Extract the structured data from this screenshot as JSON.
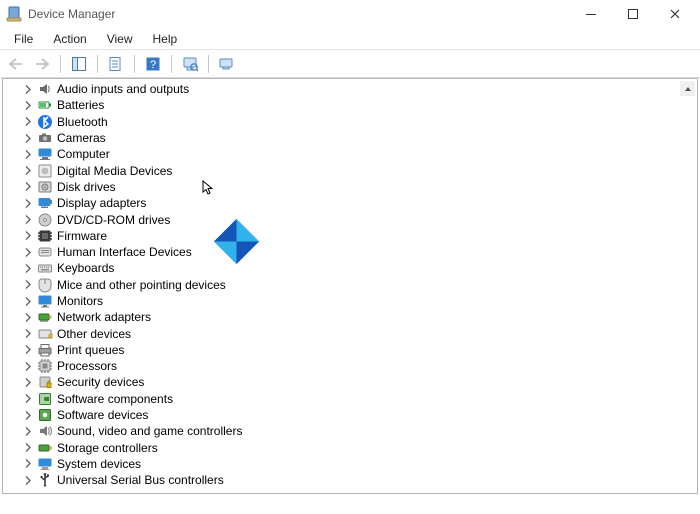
{
  "window": {
    "title": "Device Manager"
  },
  "menu": {
    "file": "File",
    "action": "Action",
    "view": "View",
    "help": "Help"
  },
  "tree": {
    "items": [
      "Audio inputs and outputs",
      "Batteries",
      "Bluetooth",
      "Cameras",
      "Computer",
      "Digital Media Devices",
      "Disk drives",
      "Display adapters",
      "DVD/CD-ROM drives",
      "Firmware",
      "Human Interface Devices",
      "Keyboards",
      "Mice and other pointing devices",
      "Monitors",
      "Network adapters",
      "Other devices",
      "Print queues",
      "Processors",
      "Security devices",
      "Software components",
      "Software devices",
      "Sound, video and game controllers",
      "Storage controllers",
      "System devices",
      "Universal Serial Bus controllers"
    ]
  }
}
